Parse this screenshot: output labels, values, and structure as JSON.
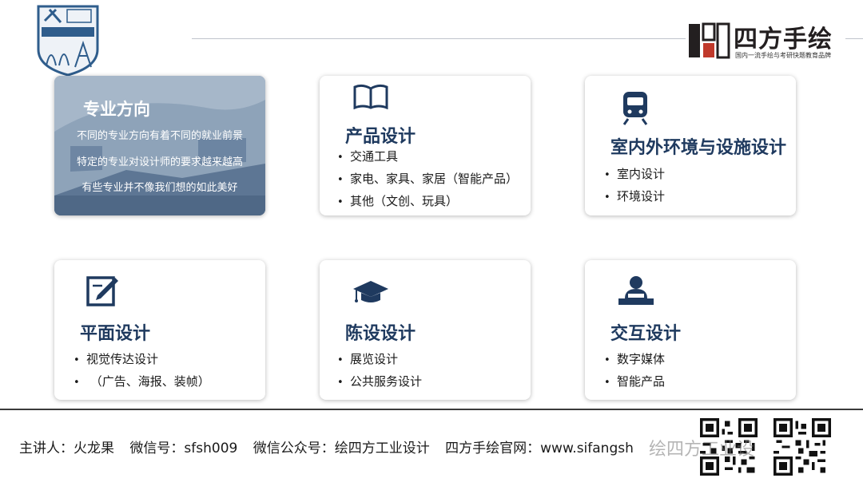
{
  "brand": {
    "name": "四方手绘",
    "slogan": "国内一流手绘与考研快题教育品牌"
  },
  "feature": {
    "title": "专业方向",
    "lines": [
      "不同的专业方向有着不同的就业前景",
      "特定的专业对设计师的要求越来越高",
      "有些专业并不像我们想的如此美好"
    ]
  },
  "cards": [
    {
      "title": "产品设计",
      "icon": "book-icon",
      "items": [
        "交通工具",
        "家电、家具、家居（智能产品）",
        "其他（文创、玩具）"
      ]
    },
    {
      "title": "室内外环境与设施设计",
      "icon": "train-icon",
      "items": [
        "室内设计",
        "环境设计"
      ]
    },
    {
      "title": "平面设计",
      "icon": "edit-icon",
      "items": [
        "视觉传达设计",
        " （广告、海报、装帧）"
      ]
    },
    {
      "title": "陈设设计",
      "icon": "graduation-cap-icon",
      "items": [
        "展览设计",
        "公共服务设计"
      ]
    },
    {
      "title": "交互设计",
      "icon": "user-at-desk-icon",
      "items": [
        "数字媒体",
        "智能产品"
      ]
    }
  ],
  "footer": {
    "speaker": "主讲人：火龙果",
    "wechat": "微信号：sfsh009",
    "official": "微信公众号：绘四方工业设计",
    "website": "四方手绘官网：www.sifangsh"
  },
  "watermark": "绘四方工业设",
  "colors": {
    "title": "#1f3a5f",
    "icon": "#1f3a5f",
    "feature_bg": "#7d93ab"
  }
}
